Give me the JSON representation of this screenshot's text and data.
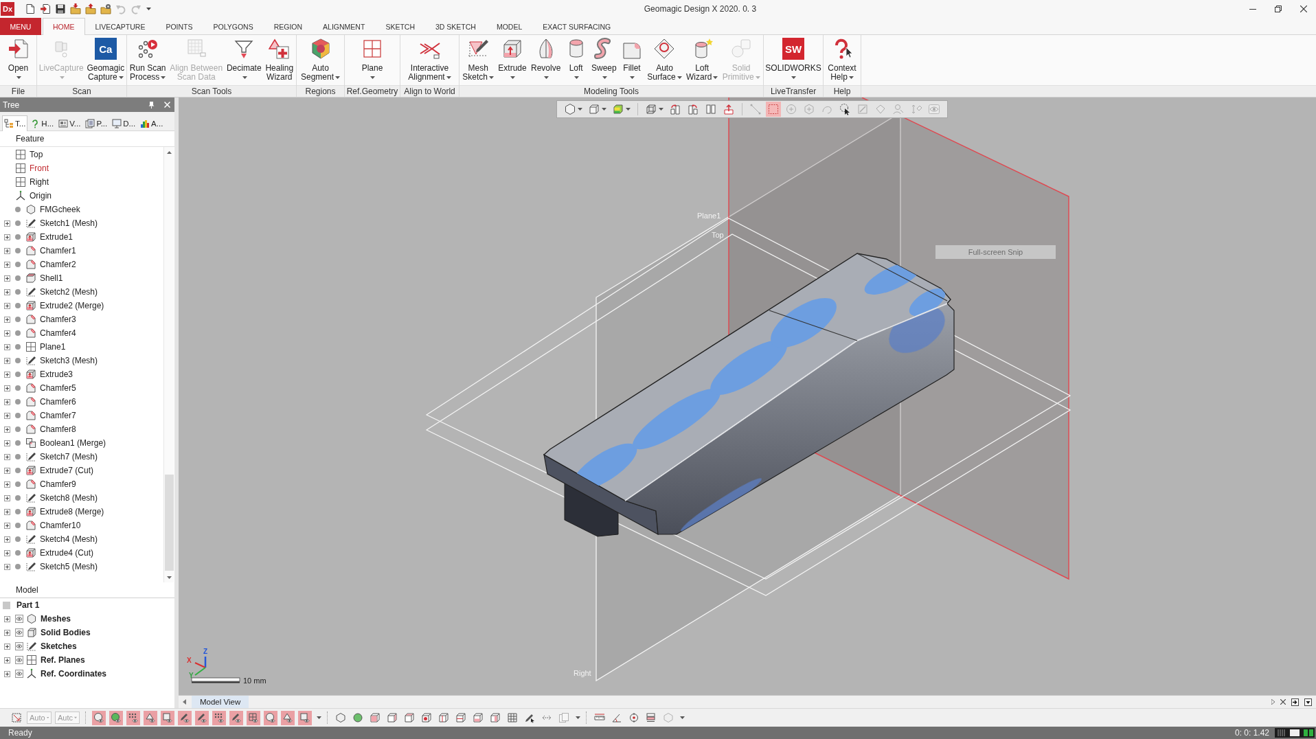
{
  "window": {
    "app_logo": "Dx",
    "title": "Geomagic Design X 2020. 0. 3"
  },
  "quick_access": [
    {
      "disabled": false
    },
    {
      "disabled": false
    },
    {
      "disabled": false
    },
    {
      "disabled": false
    },
    {
      "disabled": false
    },
    {
      "disabled": false
    },
    {
      "disabled": true
    },
    {
      "disabled": true
    }
  ],
  "ribbon_tabs": [
    {
      "label": "MENU",
      "kind": "menu",
      "selected": false
    },
    {
      "label": "HOME",
      "kind": "tab",
      "selected": true
    },
    {
      "label": "LIVECAPTURE",
      "kind": "tab",
      "selected": false
    },
    {
      "label": "POINTS",
      "kind": "tab",
      "selected": false
    },
    {
      "label": "POLYGONS",
      "kind": "tab",
      "selected": false
    },
    {
      "label": "REGION",
      "kind": "tab",
      "selected": false
    },
    {
      "label": "ALIGNMENT",
      "kind": "tab",
      "selected": false
    },
    {
      "label": "SKETCH",
      "kind": "tab",
      "selected": false
    },
    {
      "label": "3D SKETCH",
      "kind": "tab",
      "selected": false
    },
    {
      "label": "MODEL",
      "kind": "tab",
      "selected": false
    },
    {
      "label": "EXACT SURFACING",
      "kind": "tab",
      "selected": false
    }
  ],
  "ribbon_groups": [
    {
      "label": "File",
      "buttons": [
        {
          "lines": [
            "Open"
          ],
          "dropdown": true,
          "disabled": false
        }
      ]
    },
    {
      "label": "Scan",
      "buttons": [
        {
          "lines": [
            "LiveCapture"
          ],
          "dropdown": true,
          "disabled": true
        },
        {
          "lines": [
            "Geomagic",
            "Capture"
          ],
          "logo_text": "Ca",
          "dropdown": true,
          "disabled": false
        }
      ]
    },
    {
      "label": "Scan Tools",
      "buttons": [
        {
          "lines": [
            "Run Scan",
            "Process"
          ],
          "dropdown": true,
          "disabled": false
        },
        {
          "lines": [
            "Align Between",
            "Scan Data"
          ],
          "dropdown": false,
          "disabled": true
        },
        {
          "lines": [
            "Decimate"
          ],
          "dropdown": true,
          "disabled": false
        },
        {
          "lines": [
            "Healing",
            "Wizard"
          ],
          "dropdown": false,
          "disabled": false
        }
      ]
    },
    {
      "label": "Regions",
      "buttons": [
        {
          "lines": [
            "Auto",
            "Segment"
          ],
          "dropdown": true,
          "disabled": false
        }
      ]
    },
    {
      "label": "Ref.Geometry",
      "buttons": [
        {
          "lines": [
            "Plane"
          ],
          "dropdown": true,
          "disabled": false
        }
      ]
    },
    {
      "label": "Align to World",
      "buttons": [
        {
          "lines": [
            "Interactive",
            "Alignment"
          ],
          "dropdown": true,
          "disabled": false
        }
      ]
    },
    {
      "label": "Modeling Tools",
      "buttons": [
        {
          "lines": [
            "Mesh",
            "Sketch"
          ],
          "dropdown": true,
          "disabled": false
        },
        {
          "lines": [
            "Extrude"
          ],
          "dropdown": true,
          "disabled": false
        },
        {
          "lines": [
            "Revolve"
          ],
          "dropdown": true,
          "disabled": false
        },
        {
          "lines": [
            "Loft"
          ],
          "dropdown": true,
          "disabled": false
        },
        {
          "lines": [
            "Sweep"
          ],
          "dropdown": true,
          "disabled": false
        },
        {
          "lines": [
            "Fillet"
          ],
          "dropdown": true,
          "disabled": false
        },
        {
          "lines": [
            "Auto",
            "Surface"
          ],
          "dropdown": true,
          "disabled": false
        },
        {
          "lines": [
            "Loft",
            "Wizard"
          ],
          "dropdown": true,
          "disabled": false
        },
        {
          "lines": [
            "Solid",
            "Primitive"
          ],
          "dropdown": true,
          "disabled": true
        }
      ]
    },
    {
      "label": "LiveTransfer",
      "buttons": [
        {
          "lines": [
            "SOLIDWORKS"
          ],
          "logo_text": "SW",
          "dropdown": true,
          "disabled": false
        }
      ]
    },
    {
      "label": "Help",
      "buttons": [
        {
          "lines": [
            "Context",
            "Help"
          ],
          "dropdown": true,
          "disabled": false
        }
      ]
    }
  ],
  "tree_panel": {
    "title": "Tree",
    "tabs": [
      {
        "label": "T...",
        "selected": true
      },
      {
        "label": "H...",
        "selected": false
      },
      {
        "label": "V...",
        "selected": false
      },
      {
        "label": "P...",
        "selected": false
      },
      {
        "label": "D...",
        "selected": false
      },
      {
        "label": "A...",
        "selected": false
      }
    ],
    "feature_header": "Feature",
    "features": [
      {
        "label": "Top",
        "kind": "plane",
        "expandable": false,
        "status_dot": false,
        "selected": false
      },
      {
        "label": "Front",
        "kind": "plane",
        "expandable": false,
        "status_dot": false,
        "selected": true
      },
      {
        "label": "Right",
        "kind": "plane",
        "expandable": false,
        "status_dot": false,
        "selected": false
      },
      {
        "label": "Origin",
        "kind": "origin",
        "expandable": false,
        "status_dot": false,
        "selected": false
      },
      {
        "label": "FMGcheek",
        "kind": "mesh",
        "expandable": false,
        "status_dot": true,
        "selected": false
      },
      {
        "label": "Sketch1 (Mesh)",
        "kind": "sketch",
        "expandable": true,
        "status_dot": true,
        "selected": false
      },
      {
        "label": "Extrude1",
        "kind": "extrude",
        "expandable": true,
        "status_dot": true,
        "selected": false
      },
      {
        "label": "Chamfer1",
        "kind": "chamfer",
        "expandable": true,
        "status_dot": true,
        "selected": false
      },
      {
        "label": "Chamfer2",
        "kind": "chamfer",
        "expandable": true,
        "status_dot": true,
        "selected": false
      },
      {
        "label": "Shell1",
        "kind": "shell",
        "expandable": true,
        "status_dot": true,
        "selected": false
      },
      {
        "label": "Sketch2 (Mesh)",
        "kind": "sketch",
        "expandable": true,
        "status_dot": true,
        "selected": false
      },
      {
        "label": "Extrude2 (Merge)",
        "kind": "extrude",
        "expandable": true,
        "status_dot": true,
        "selected": false
      },
      {
        "label": "Chamfer3",
        "kind": "chamfer",
        "expandable": true,
        "status_dot": true,
        "selected": false
      },
      {
        "label": "Chamfer4",
        "kind": "chamfer",
        "expandable": true,
        "status_dot": true,
        "selected": false
      },
      {
        "label": "Plane1",
        "kind": "plane",
        "expandable": true,
        "status_dot": true,
        "selected": false
      },
      {
        "label": "Sketch3 (Mesh)",
        "kind": "sketch",
        "expandable": true,
        "status_dot": true,
        "selected": false
      },
      {
        "label": "Extrude3",
        "kind": "extrude",
        "expandable": true,
        "status_dot": true,
        "selected": false
      },
      {
        "label": "Chamfer5",
        "kind": "chamfer",
        "expandable": true,
        "status_dot": true,
        "selected": false
      },
      {
        "label": "Chamfer6",
        "kind": "chamfer",
        "expandable": true,
        "status_dot": true,
        "selected": false
      },
      {
        "label": "Chamfer7",
        "kind": "chamfer",
        "expandable": true,
        "status_dot": true,
        "selected": false
      },
      {
        "label": "Chamfer8",
        "kind": "chamfer",
        "expandable": true,
        "status_dot": true,
        "selected": false
      },
      {
        "label": "Boolean1 (Merge)",
        "kind": "boolean",
        "expandable": true,
        "status_dot": true,
        "selected": false
      },
      {
        "label": "Sketch7 (Mesh)",
        "kind": "sketch",
        "expandable": true,
        "status_dot": true,
        "selected": false
      },
      {
        "label": "Extrude7 (Cut)",
        "kind": "extrude",
        "expandable": true,
        "status_dot": true,
        "selected": false
      },
      {
        "label": "Chamfer9",
        "kind": "chamfer",
        "expandable": true,
        "status_dot": true,
        "selected": false
      },
      {
        "label": "Sketch8 (Mesh)",
        "kind": "sketch",
        "expandable": true,
        "status_dot": true,
        "selected": false
      },
      {
        "label": "Extrude8 (Merge)",
        "kind": "extrude",
        "expandable": true,
        "status_dot": true,
        "selected": false
      },
      {
        "label": "Chamfer10",
        "kind": "chamfer",
        "expandable": true,
        "status_dot": true,
        "selected": false
      },
      {
        "label": "Sketch4 (Mesh)",
        "kind": "sketch",
        "expandable": true,
        "status_dot": true,
        "selected": false
      },
      {
        "label": "Extrude4 (Cut)",
        "kind": "extrude",
        "expandable": true,
        "status_dot": true,
        "selected": false
      },
      {
        "label": "Sketch5 (Mesh)",
        "kind": "sketch",
        "expandable": true,
        "status_dot": true,
        "selected": false
      }
    ],
    "model_header": "Model",
    "model_root": {
      "label": "Part 1",
      "children": [
        {
          "label": "Meshes",
          "kind": "mesh",
          "expanded": false,
          "visible": true
        },
        {
          "label": "Solid Bodies",
          "kind": "solid",
          "expanded": false,
          "visible": true
        },
        {
          "label": "Sketches",
          "kind": "sketch",
          "expanded": false,
          "visible": true
        },
        {
          "label": "Ref. Planes",
          "kind": "plane",
          "expanded": false,
          "visible": true
        },
        {
          "label": "Ref. Coordinates",
          "kind": "origin",
          "expanded": false,
          "visible": true
        }
      ]
    }
  },
  "viewport": {
    "view_toolbar": [
      {
        "dropdown": true,
        "selected": false,
        "disabled": false
      },
      {
        "dropdown": true,
        "selected": false,
        "disabled": false
      },
      {
        "dropdown": true,
        "selected": false,
        "disabled": false
      },
      {
        "dropdown": true,
        "selected": false,
        "disabled": false
      },
      {
        "dropdown": false,
        "selected": false,
        "disabled": false
      },
      {
        "dropdown": false,
        "selected": false,
        "disabled": false
      },
      {
        "dropdown": false,
        "selected": false,
        "disabled": false
      },
      {
        "dropdown": false,
        "selected": false,
        "disabled": false
      },
      {
        "dropdown": false,
        "selected": false,
        "disabled": true
      },
      {
        "dropdown": false,
        "selected": true,
        "disabled": false
      },
      {
        "dropdown": false,
        "selected": false,
        "disabled": true
      },
      {
        "dropdown": false,
        "selected": false,
        "disabled": true
      },
      {
        "dropdown": false,
        "selected": false,
        "disabled": true
      },
      {
        "dropdown": false,
        "selected": false,
        "disabled": false
      },
      {
        "dropdown": false,
        "selected": false,
        "disabled": true
      },
      {
        "dropdown": false,
        "selected": false,
        "disabled": true
      },
      {
        "dropdown": false,
        "selected": false,
        "disabled": true
      },
      {
        "dropdown": false,
        "selected": false,
        "disabled": true
      },
      {
        "dropdown": false,
        "selected": false,
        "disabled": true
      }
    ],
    "plane_labels": [
      "Plane1",
      "Top",
      "Right"
    ],
    "snip_hint": "Full-screen Snip",
    "axis_labels": [
      "Z",
      "X",
      "Y"
    ],
    "scale_label": "10 mm"
  },
  "document_tabs": [
    {
      "label": "Model View",
      "selected": true
    }
  ],
  "bottom_toolbar": {
    "combos": [
      {
        "value": "Auto",
        "disabled": true
      },
      {
        "value": "Autc",
        "disabled": true
      }
    ],
    "filters": [
      {
        "on": true
      },
      {
        "on": true
      },
      {
        "on": true
      },
      {
        "on": true
      },
      {
        "on": true
      },
      {
        "on": true
      },
      {
        "on": true
      },
      {
        "on": true
      },
      {
        "on": true
      },
      {
        "on": true
      },
      {
        "on": true
      },
      {
        "on": true
      },
      {
        "on": true
      }
    ],
    "views": [
      {
        "disabled": false
      },
      {
        "disabled": false
      },
      {
        "disabled": false
      },
      {
        "disabled": false
      },
      {
        "disabled": false
      },
      {
        "disabled": false
      },
      {
        "disabled": false
      },
      {
        "disabled": false
      },
      {
        "disabled": false
      },
      {
        "disabled": false
      },
      {
        "disabled": false
      },
      {
        "disabled": false
      },
      {
        "disabled": false
      },
      {
        "disabled": true
      }
    ],
    "tools": [
      {
        "disabled": false
      },
      {
        "disabled": false
      },
      {
        "disabled": false
      },
      {
        "disabled": false
      },
      {
        "disabled": true
      }
    ]
  },
  "status_bar": {
    "message": "Ready",
    "clock": "0: 0: 1.42"
  }
}
